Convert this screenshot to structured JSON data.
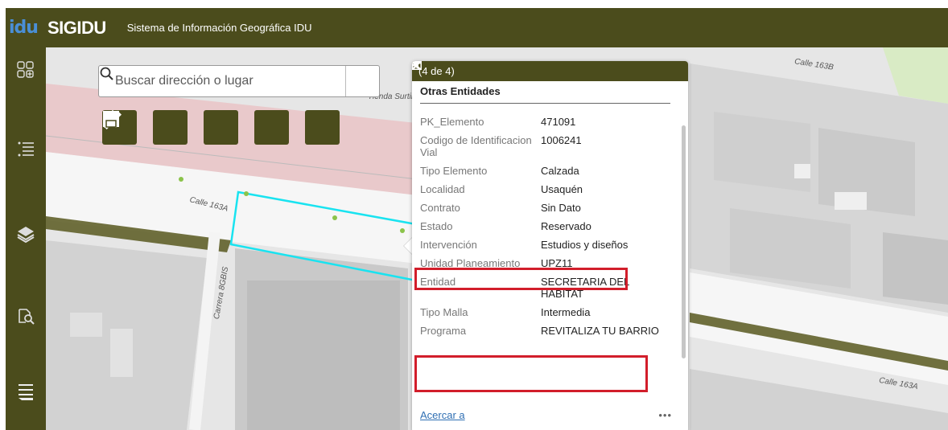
{
  "header": {
    "logo": "idu",
    "app_name": "SIGIDU",
    "subtitle": "Sistema de Información Geográfica IDU"
  },
  "sidebar": {
    "items": [
      {
        "icon": "widgets-icon"
      },
      {
        "icon": "legend-list-icon"
      },
      {
        "icon": "layers-icon"
      },
      {
        "icon": "query-icon"
      },
      {
        "icon": "menu-icon"
      }
    ]
  },
  "search": {
    "placeholder": "Buscar dirección o lugar",
    "button_icon": "search-icon"
  },
  "tools": [
    {
      "icon": "graduation-cap-icon"
    },
    {
      "icon": "basemap-gallery-icon"
    },
    {
      "icon": "coordinates-icon"
    },
    {
      "icon": "measure-ruler-icon"
    },
    {
      "icon": "print-icon"
    }
  ],
  "map_labels": {
    "calle_163a_top": "Calle 163A",
    "calle_163b": "Calle 163B",
    "carrera": "Carrera 8GBIS",
    "tienda": "Tienda Surtir",
    "calle_163a_right": "Calle 163A"
  },
  "popup": {
    "count": "(4 de 4)",
    "title": "Otras Entidades",
    "attributes": [
      {
        "key": "PK_Elemento",
        "value": "471091"
      },
      {
        "key": "Codigo de Identificacion Vial",
        "value": "1006241"
      },
      {
        "key": "Tipo Elemento",
        "value": "Calzada"
      },
      {
        "key": "Localidad",
        "value": "Usaquén"
      },
      {
        "key": "Contrato",
        "value": "Sin Dato"
      },
      {
        "key": "Estado",
        "value": "Reservado"
      },
      {
        "key": "Intervención",
        "value": "Estudios y diseños"
      },
      {
        "key": "Unidad Planeamiento",
        "value": "UPZ11"
      },
      {
        "key": "Entidad",
        "value": "SECRETARIA DEL HABITAT"
      },
      {
        "key": "Tipo Malla",
        "value": "Intermedia"
      },
      {
        "key": "Programa",
        "value": "REVITALIZA TU BARRIO"
      }
    ],
    "zoom_link": "Acercar a",
    "more": "•••"
  },
  "colors": {
    "header_bg": "#4b4c1c",
    "highlight_red": "#d21e2b",
    "selection_cyan": "#19e3f0",
    "link_blue": "#2f6fb3"
  }
}
